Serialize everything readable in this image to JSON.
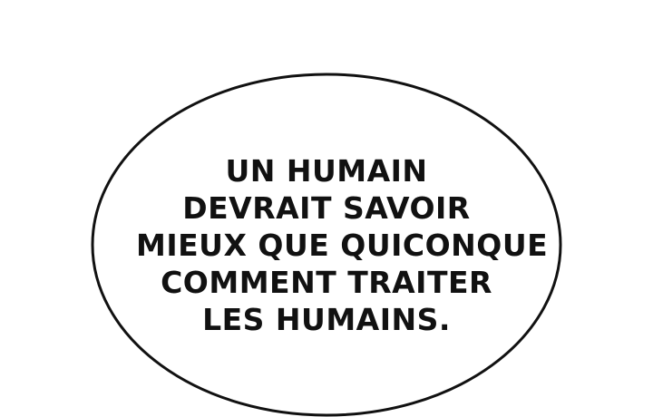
{
  "speech_bubble": {
    "lines": [
      "UN HUMAIN",
      "DEVRAIT SAVOIR",
      "MIEUX QUE QUICONQUE",
      "COMMENT TRAITER",
      "LES HUMAINS."
    ]
  },
  "colors": {
    "background": "#ffffff",
    "outline": "#111111",
    "text": "#111111"
  }
}
